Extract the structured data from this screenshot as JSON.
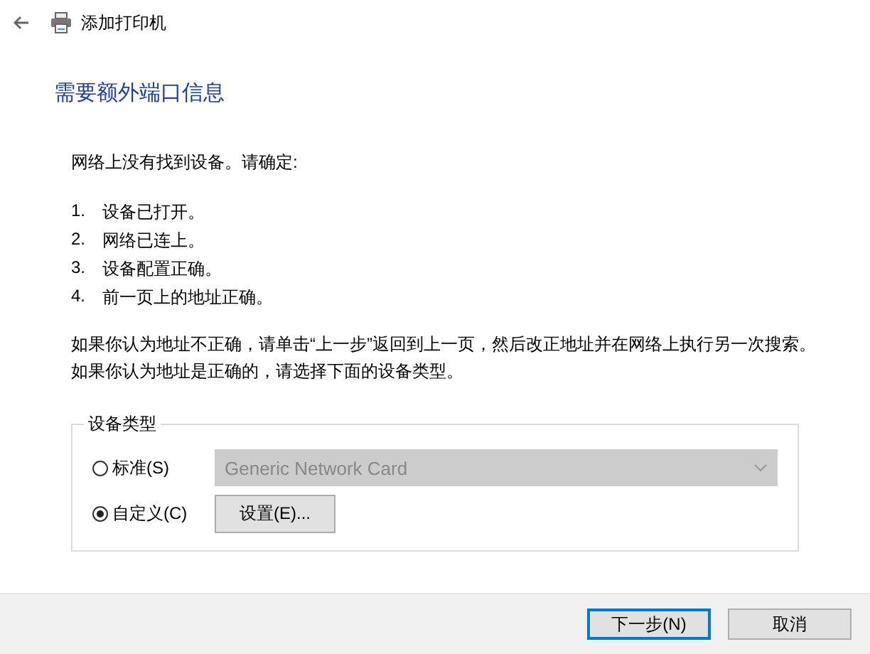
{
  "window": {
    "title": "添加打印机"
  },
  "heading": "需要额外端口信息",
  "intro": "网络上没有找到设备。请确定:",
  "checklist": [
    {
      "number": "1.",
      "text": "设备已打开。"
    },
    {
      "number": "2.",
      "text": "网络已连上。"
    },
    {
      "number": "3.",
      "text": "设备配置正确。"
    },
    {
      "number": "4.",
      "text": "前一页上的地址正确。"
    }
  ],
  "paragraphs": [
    "如果你认为地址不正确，请单击“上一步”返回到上一页，然后改正地址并在网络上执行另一次搜索。",
    "如果你认为地址是正确的，请选择下面的设备类型。"
  ],
  "device_type": {
    "title": "设备类型",
    "options": [
      {
        "label": "标准(S)",
        "selected": false,
        "kind": "dropdown",
        "value": "Generic Network Card",
        "disabled": true
      },
      {
        "label": "自定义(C)",
        "selected": true,
        "kind": "button",
        "button": "设置(E)..."
      }
    ]
  },
  "buttons": [
    {
      "label": "下一步(N)",
      "default": true
    },
    {
      "label": "取消",
      "default": false
    }
  ]
}
